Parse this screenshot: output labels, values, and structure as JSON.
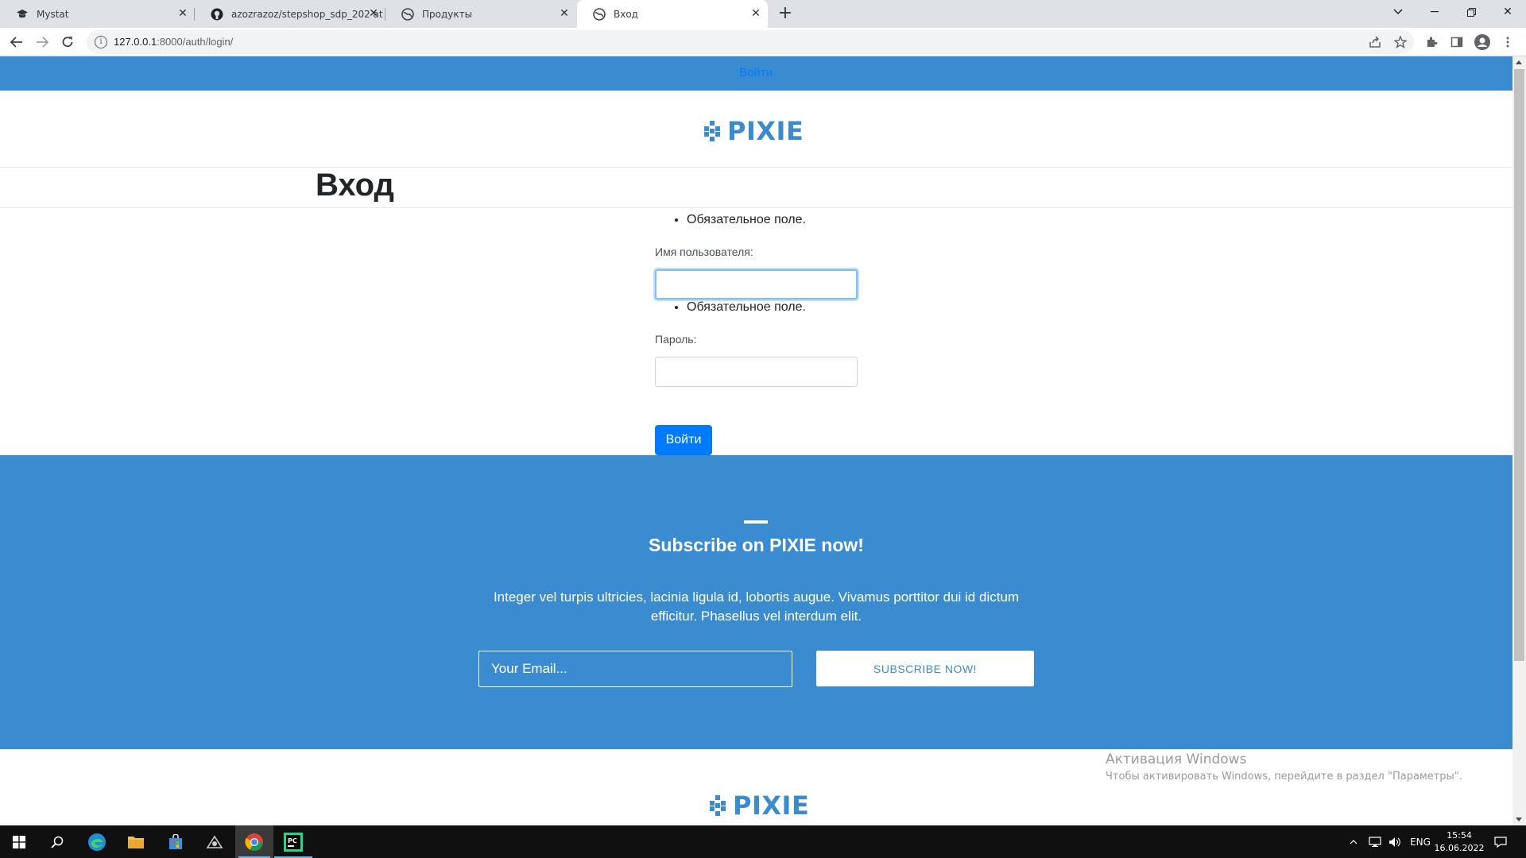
{
  "browser": {
    "tabs": [
      {
        "title": "Mystat",
        "icon": "graduation-cap-icon"
      },
      {
        "title": "azozrazoz/stepshop_sdp_202 at",
        "icon": "github-icon"
      },
      {
        "title": "Продукты",
        "icon": "globe-icon"
      },
      {
        "title": "Вход",
        "icon": "globe-icon",
        "active": true
      }
    ],
    "new_tab_label": "+",
    "url_host": "127.0.0.1",
    "url_path": ":8000/auth/login/"
  },
  "page": {
    "nav_login": "Войти",
    "logo_text": "PIXIE",
    "title": "Вход",
    "error_required": "Обязательное поле.",
    "username_label": "Имя пользователя:",
    "password_label": "Пароль:",
    "login_button": "Войти"
  },
  "subscribe": {
    "heading": "Subscribe on PIXIE now!",
    "description": "Integer vel turpis ultricies, lacinia ligula id, lobortis augue. Vivamus porttitor dui id dictum efficitur. Phasellus vel interdum elit.",
    "email_placeholder": "Your Email...",
    "button": "SUBSCRIBE NOW!"
  },
  "footer": {
    "logo_text": "PIXIE"
  },
  "watermark": {
    "title": "Активация Windows",
    "subtitle": "Чтобы активировать Windows, перейдите в раздел \"Параметры\"."
  },
  "taskbar": {
    "language": "ENG",
    "time": "15:54",
    "date": "16.06.2022"
  },
  "colors": {
    "brand_blue": "#3b8bd0",
    "link_blue": "#007bff"
  }
}
